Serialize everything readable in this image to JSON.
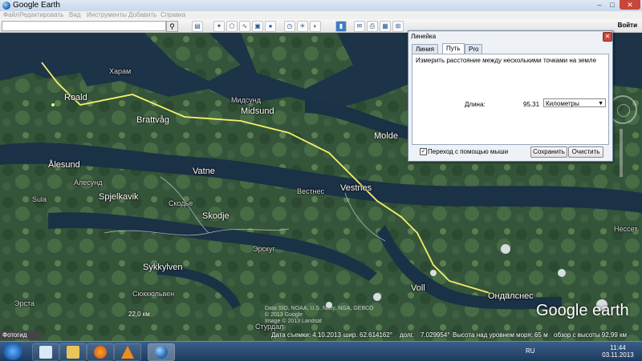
{
  "window": {
    "title": "Google Earth",
    "controls": {
      "minimize": "–",
      "maximize": "□",
      "close": "✕"
    },
    "sign_in": "Войти"
  },
  "menu": {
    "items": [
      "Файл",
      "Редактировать",
      "Вид",
      "Инструменты",
      "Добавить",
      "Справка"
    ]
  },
  "toolbar": {
    "search_placeholder": "",
    "search_icon": "search-icon",
    "tools": [
      "sidebar",
      "placemark",
      "polygon",
      "path",
      "overlay",
      "record-tour",
      "history",
      "sun",
      "planets",
      "ruler",
      "email",
      "print",
      "save-image",
      "maps"
    ]
  },
  "map": {
    "places": [
      {
        "name": "Харам",
        "kind": "small"
      },
      {
        "name": "Roald",
        "kind": "main"
      },
      {
        "name": "Brattvåg",
        "kind": "main"
      },
      {
        "name": "Мидсунд",
        "kind": "small"
      },
      {
        "name": "Midsund",
        "kind": "main"
      },
      {
        "name": "Molde",
        "kind": "main"
      },
      {
        "name": "Ålesund",
        "kind": "main"
      },
      {
        "name": "Алесунд",
        "kind": "small"
      },
      {
        "name": "Vatne",
        "kind": "main"
      },
      {
        "name": "Sula",
        "kind": "small"
      },
      {
        "name": "Spjelkavik",
        "kind": "main"
      },
      {
        "name": "Skodje",
        "kind": "main"
      },
      {
        "name": "Скодье",
        "kind": "small"
      },
      {
        "name": "Вестнес",
        "kind": "small"
      },
      {
        "name": "Vestnes",
        "kind": "main"
      },
      {
        "name": "Эрскуг",
        "kind": "small"
      },
      {
        "name": "Sykkylven",
        "kind": "main"
      },
      {
        "name": "Сюккюльвен",
        "kind": "small"
      },
      {
        "name": "Voll",
        "kind": "main"
      },
      {
        "name": "Ондалснес",
        "kind": "main"
      },
      {
        "name": "Нессет",
        "kind": "small"
      },
      {
        "name": "Эрста",
        "kind": "small"
      },
      {
        "name": "Стурдал",
        "kind": "small"
      }
    ],
    "path_color": "#f5f06a",
    "logo": "Google earth",
    "copyright": [
      "Data SIO, NOAA, U.S. Navy, NGA, GEBCO",
      "© 2013 Google",
      "Image © 2013 Landsat"
    ]
  },
  "ruler": {
    "title": "Линейка",
    "close": "✕",
    "tabs": [
      {
        "label": "Линия",
        "active": false
      },
      {
        "label": "Путь",
        "active": true
      },
      {
        "label": "Pro",
        "active": false
      }
    ],
    "hint": "Измерить расстояние между несколькими точками на земле",
    "length_label": "Длина:",
    "length_value": "95,31",
    "unit": "Километры",
    "mouse_nav_label": "Переход с помощью мыши",
    "mouse_nav_checked": true,
    "save_label": "Сохранить",
    "clear_label": "Очистить"
  },
  "status": {
    "tour_label": "Фотогид",
    "date": "Дата съемки: 4.10.2013",
    "lat_label": "шир.",
    "lat": "62.614162°",
    "lon_label": "долг.",
    "lon": "7.029954°",
    "elev_label": "Высота над уровнем моря:",
    "elev": "65 м",
    "eye": "обзор с высоты 92,99 км",
    "scale": "22,0 км"
  },
  "taskbar": {
    "language": "RU",
    "time": "11:44",
    "date": "03.11.2013",
    "apps": [
      "explorer",
      "folder",
      "firefox",
      "vlc",
      "google-earth"
    ]
  }
}
